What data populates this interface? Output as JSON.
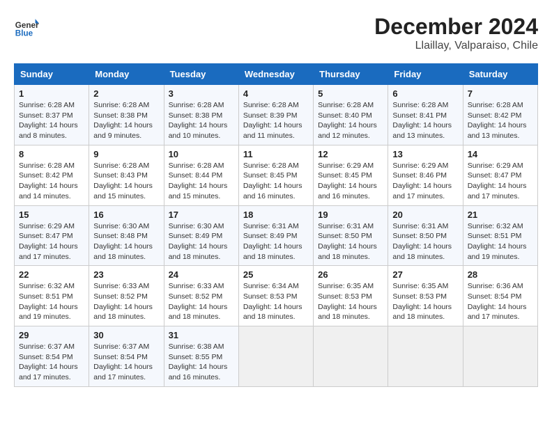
{
  "header": {
    "logo": {
      "general": "General",
      "blue": "Blue"
    },
    "title": "December 2024",
    "location": "Llaillay, Valparaiso, Chile"
  },
  "calendar": {
    "days_of_week": [
      "Sunday",
      "Monday",
      "Tuesday",
      "Wednesday",
      "Thursday",
      "Friday",
      "Saturday"
    ],
    "weeks": [
      [
        {
          "day": "1",
          "sunrise": "6:28 AM",
          "sunset": "8:37 PM",
          "daylight": "14 hours and 8 minutes."
        },
        {
          "day": "2",
          "sunrise": "6:28 AM",
          "sunset": "8:38 PM",
          "daylight": "14 hours and 9 minutes."
        },
        {
          "day": "3",
          "sunrise": "6:28 AM",
          "sunset": "8:38 PM",
          "daylight": "14 hours and 10 minutes."
        },
        {
          "day": "4",
          "sunrise": "6:28 AM",
          "sunset": "8:39 PM",
          "daylight": "14 hours and 11 minutes."
        },
        {
          "day": "5",
          "sunrise": "6:28 AM",
          "sunset": "8:40 PM",
          "daylight": "14 hours and 12 minutes."
        },
        {
          "day": "6",
          "sunrise": "6:28 AM",
          "sunset": "8:41 PM",
          "daylight": "14 hours and 13 minutes."
        },
        {
          "day": "7",
          "sunrise": "6:28 AM",
          "sunset": "8:42 PM",
          "daylight": "14 hours and 13 minutes."
        }
      ],
      [
        {
          "day": "8",
          "sunrise": "6:28 AM",
          "sunset": "8:42 PM",
          "daylight": "14 hours and 14 minutes."
        },
        {
          "day": "9",
          "sunrise": "6:28 AM",
          "sunset": "8:43 PM",
          "daylight": "14 hours and 15 minutes."
        },
        {
          "day": "10",
          "sunrise": "6:28 AM",
          "sunset": "8:44 PM",
          "daylight": "14 hours and 15 minutes."
        },
        {
          "day": "11",
          "sunrise": "6:28 AM",
          "sunset": "8:45 PM",
          "daylight": "14 hours and 16 minutes."
        },
        {
          "day": "12",
          "sunrise": "6:29 AM",
          "sunset": "8:45 PM",
          "daylight": "14 hours and 16 minutes."
        },
        {
          "day": "13",
          "sunrise": "6:29 AM",
          "sunset": "8:46 PM",
          "daylight": "14 hours and 17 minutes."
        },
        {
          "day": "14",
          "sunrise": "6:29 AM",
          "sunset": "8:47 PM",
          "daylight": "14 hours and 17 minutes."
        }
      ],
      [
        {
          "day": "15",
          "sunrise": "6:29 AM",
          "sunset": "8:47 PM",
          "daylight": "14 hours and 17 minutes."
        },
        {
          "day": "16",
          "sunrise": "6:30 AM",
          "sunset": "8:48 PM",
          "daylight": "14 hours and 18 minutes."
        },
        {
          "day": "17",
          "sunrise": "6:30 AM",
          "sunset": "8:49 PM",
          "daylight": "14 hours and 18 minutes."
        },
        {
          "day": "18",
          "sunrise": "6:31 AM",
          "sunset": "8:49 PM",
          "daylight": "14 hours and 18 minutes."
        },
        {
          "day": "19",
          "sunrise": "6:31 AM",
          "sunset": "8:50 PM",
          "daylight": "14 hours and 18 minutes."
        },
        {
          "day": "20",
          "sunrise": "6:31 AM",
          "sunset": "8:50 PM",
          "daylight": "14 hours and 18 minutes."
        },
        {
          "day": "21",
          "sunrise": "6:32 AM",
          "sunset": "8:51 PM",
          "daylight": "14 hours and 19 minutes."
        }
      ],
      [
        {
          "day": "22",
          "sunrise": "6:32 AM",
          "sunset": "8:51 PM",
          "daylight": "14 hours and 19 minutes."
        },
        {
          "day": "23",
          "sunrise": "6:33 AM",
          "sunset": "8:52 PM",
          "daylight": "14 hours and 18 minutes."
        },
        {
          "day": "24",
          "sunrise": "6:33 AM",
          "sunset": "8:52 PM",
          "daylight": "14 hours and 18 minutes."
        },
        {
          "day": "25",
          "sunrise": "6:34 AM",
          "sunset": "8:53 PM",
          "daylight": "14 hours and 18 minutes."
        },
        {
          "day": "26",
          "sunrise": "6:35 AM",
          "sunset": "8:53 PM",
          "daylight": "14 hours and 18 minutes."
        },
        {
          "day": "27",
          "sunrise": "6:35 AM",
          "sunset": "8:53 PM",
          "daylight": "14 hours and 18 minutes."
        },
        {
          "day": "28",
          "sunrise": "6:36 AM",
          "sunset": "8:54 PM",
          "daylight": "14 hours and 17 minutes."
        }
      ],
      [
        {
          "day": "29",
          "sunrise": "6:37 AM",
          "sunset": "8:54 PM",
          "daylight": "14 hours and 17 minutes."
        },
        {
          "day": "30",
          "sunrise": "6:37 AM",
          "sunset": "8:54 PM",
          "daylight": "14 hours and 17 minutes."
        },
        {
          "day": "31",
          "sunrise": "6:38 AM",
          "sunset": "8:55 PM",
          "daylight": "14 hours and 16 minutes."
        },
        null,
        null,
        null,
        null
      ]
    ]
  }
}
